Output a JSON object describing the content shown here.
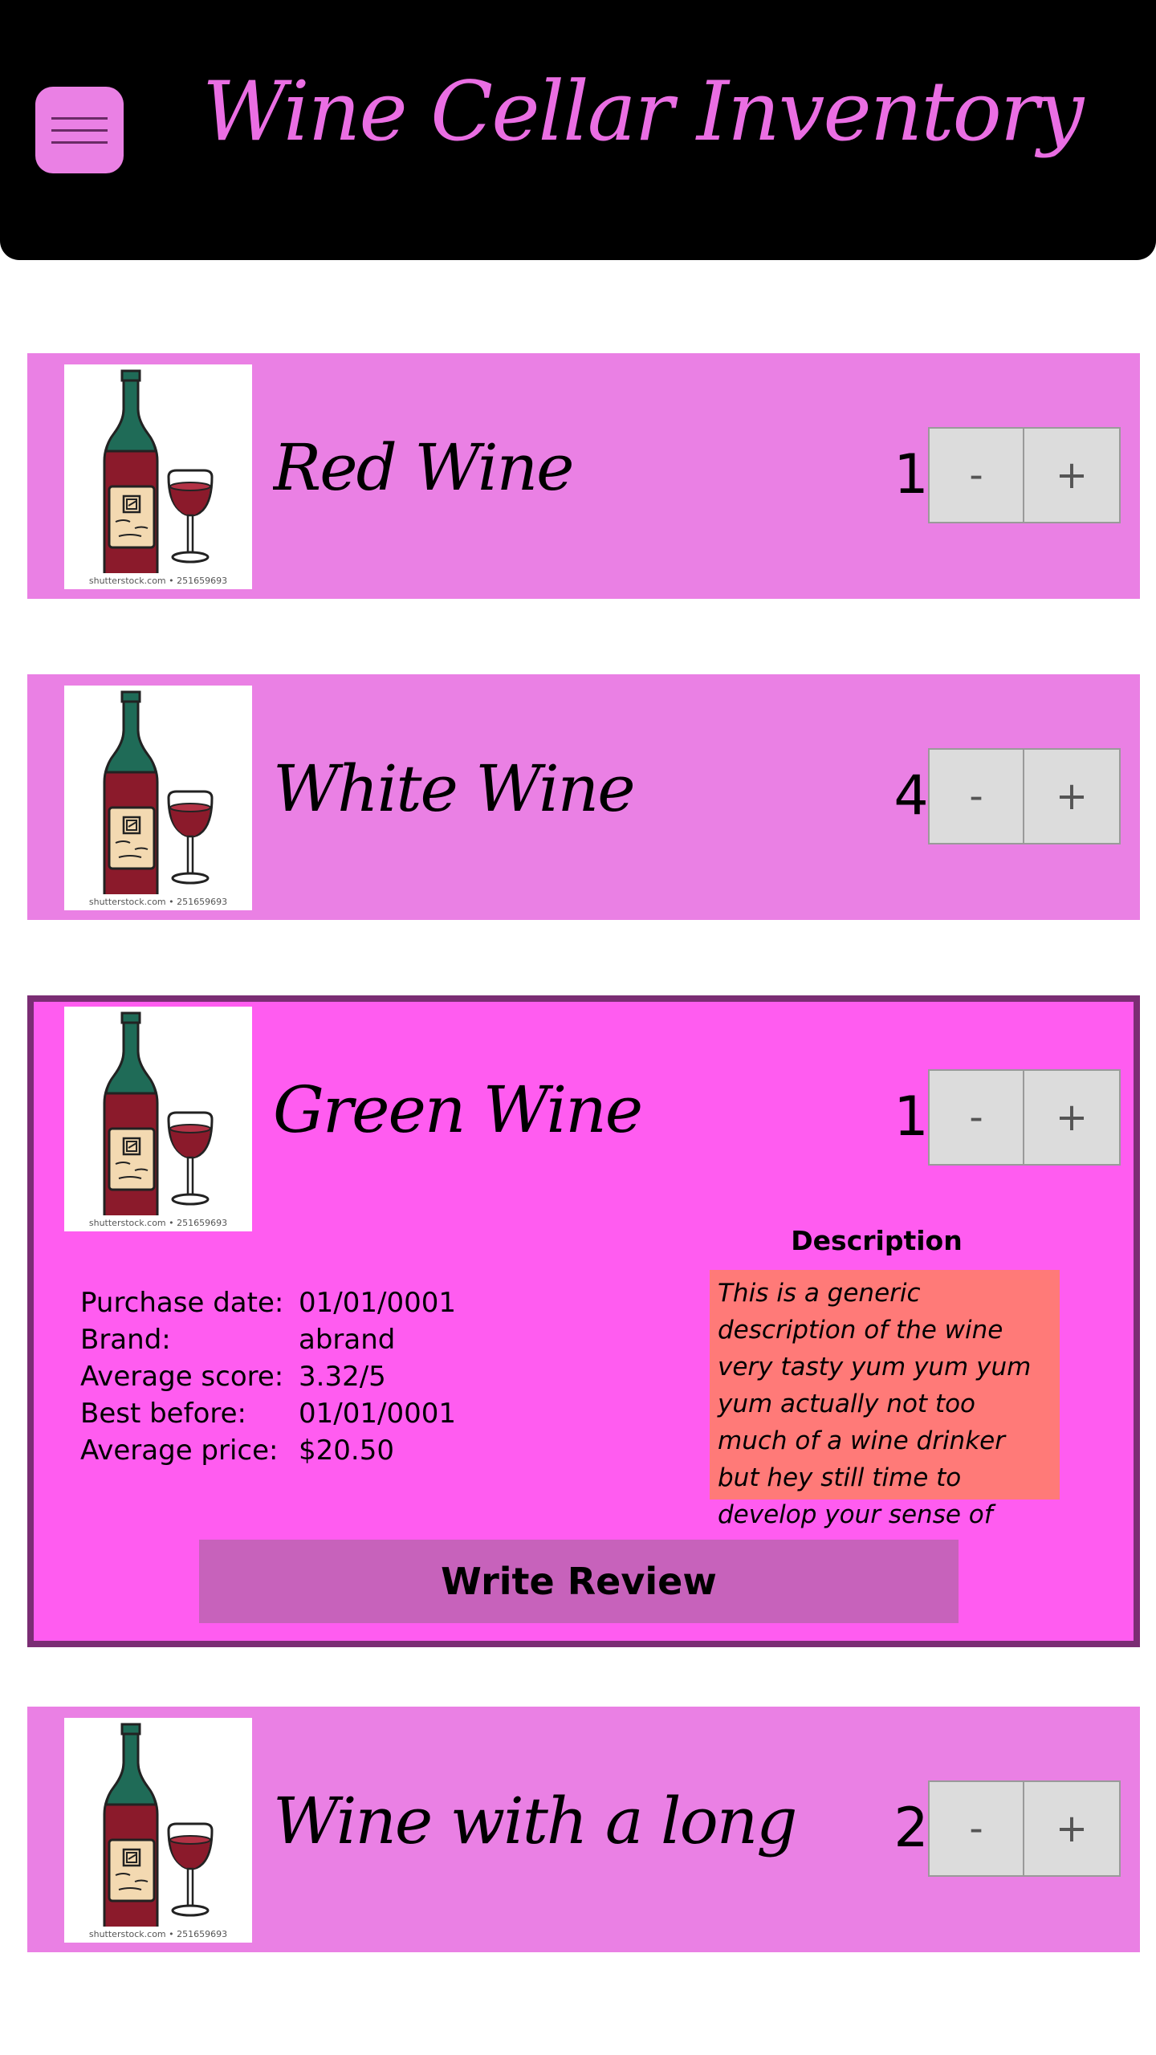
{
  "header": {
    "title": "Wine Cellar Inventory",
    "menu_icon": "hamburger-menu-icon"
  },
  "wines": [
    {
      "name": "Red Wine",
      "quantity": "1",
      "image_credit": "shutterstock.com • 251659693",
      "decrement_label": "-",
      "increment_label": "+"
    },
    {
      "name": "White Wine",
      "quantity": "4",
      "image_credit": "shutterstock.com • 251659693",
      "decrement_label": "-",
      "increment_label": "+"
    },
    {
      "name": "Green Wine",
      "quantity": "1",
      "image_credit": "shutterstock.com • 251659693",
      "decrement_label": "-",
      "increment_label": "+",
      "expanded": true,
      "details": [
        {
          "label": "Purchase date:",
          "value": "01/01/0001"
        },
        {
          "label": "Brand:",
          "value": "abrand"
        },
        {
          "label": "Average score:",
          "value": "3.32/5"
        },
        {
          "label": "Best before:",
          "value": "01/01/0001"
        },
        {
          "label": "Average price:",
          "value": "$20.50"
        }
      ],
      "description_title": "Description",
      "description": "This is a generic description of the wine very tasty yum yum yum yum actually not too much of a wine drinker but hey still time to develop your sense of taste, ya know?",
      "review_button": "Write Review"
    },
    {
      "name": "Wine with a long na-",
      "quantity": "2",
      "image_credit": "shutterstock.com • 251659693",
      "decrement_label": "-",
      "increment_label": "+"
    }
  ],
  "colors": {
    "header_bg": "#000000",
    "title_color": "#ea6ee3",
    "card_bg": "#ea80e4",
    "expanded_card_bg": "#ff5cf0",
    "expanded_border": "#7b2d74",
    "description_bg": "#ff7a78",
    "review_button_bg": "#c762bb"
  }
}
